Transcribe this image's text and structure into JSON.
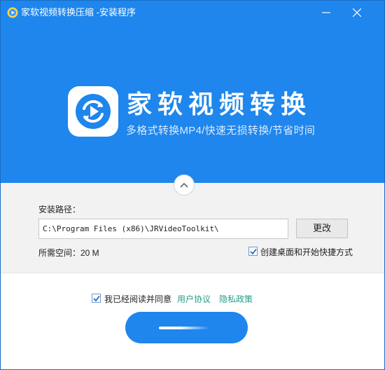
{
  "window": {
    "title": "家软视频转换压缩 -安装程序",
    "minimize_icon": "minimize-icon",
    "close_icon": "close-icon"
  },
  "hero": {
    "logo_icon": "video-convert-logo-icon",
    "brand": "家软视频转换",
    "slogan": "多格式转换MP4/快速无损转换/节省时间",
    "collapse_icon": "chevron-up-icon"
  },
  "install": {
    "path_label": "安装路径：",
    "path_value": "C:\\Program Files (x86)\\JRVideoToolkit\\",
    "change_button": "更改",
    "space_label": "所需空间：20 M",
    "shortcut_checked": true,
    "shortcut_label": "创建桌面和开始快捷方式"
  },
  "agreement": {
    "checked": true,
    "text": "我已经阅读并同意",
    "user_agreement": "用户协议",
    "privacy_policy": "隐私政策"
  },
  "colors": {
    "accent": "#1e86ec",
    "link": "#1f9e8a"
  }
}
